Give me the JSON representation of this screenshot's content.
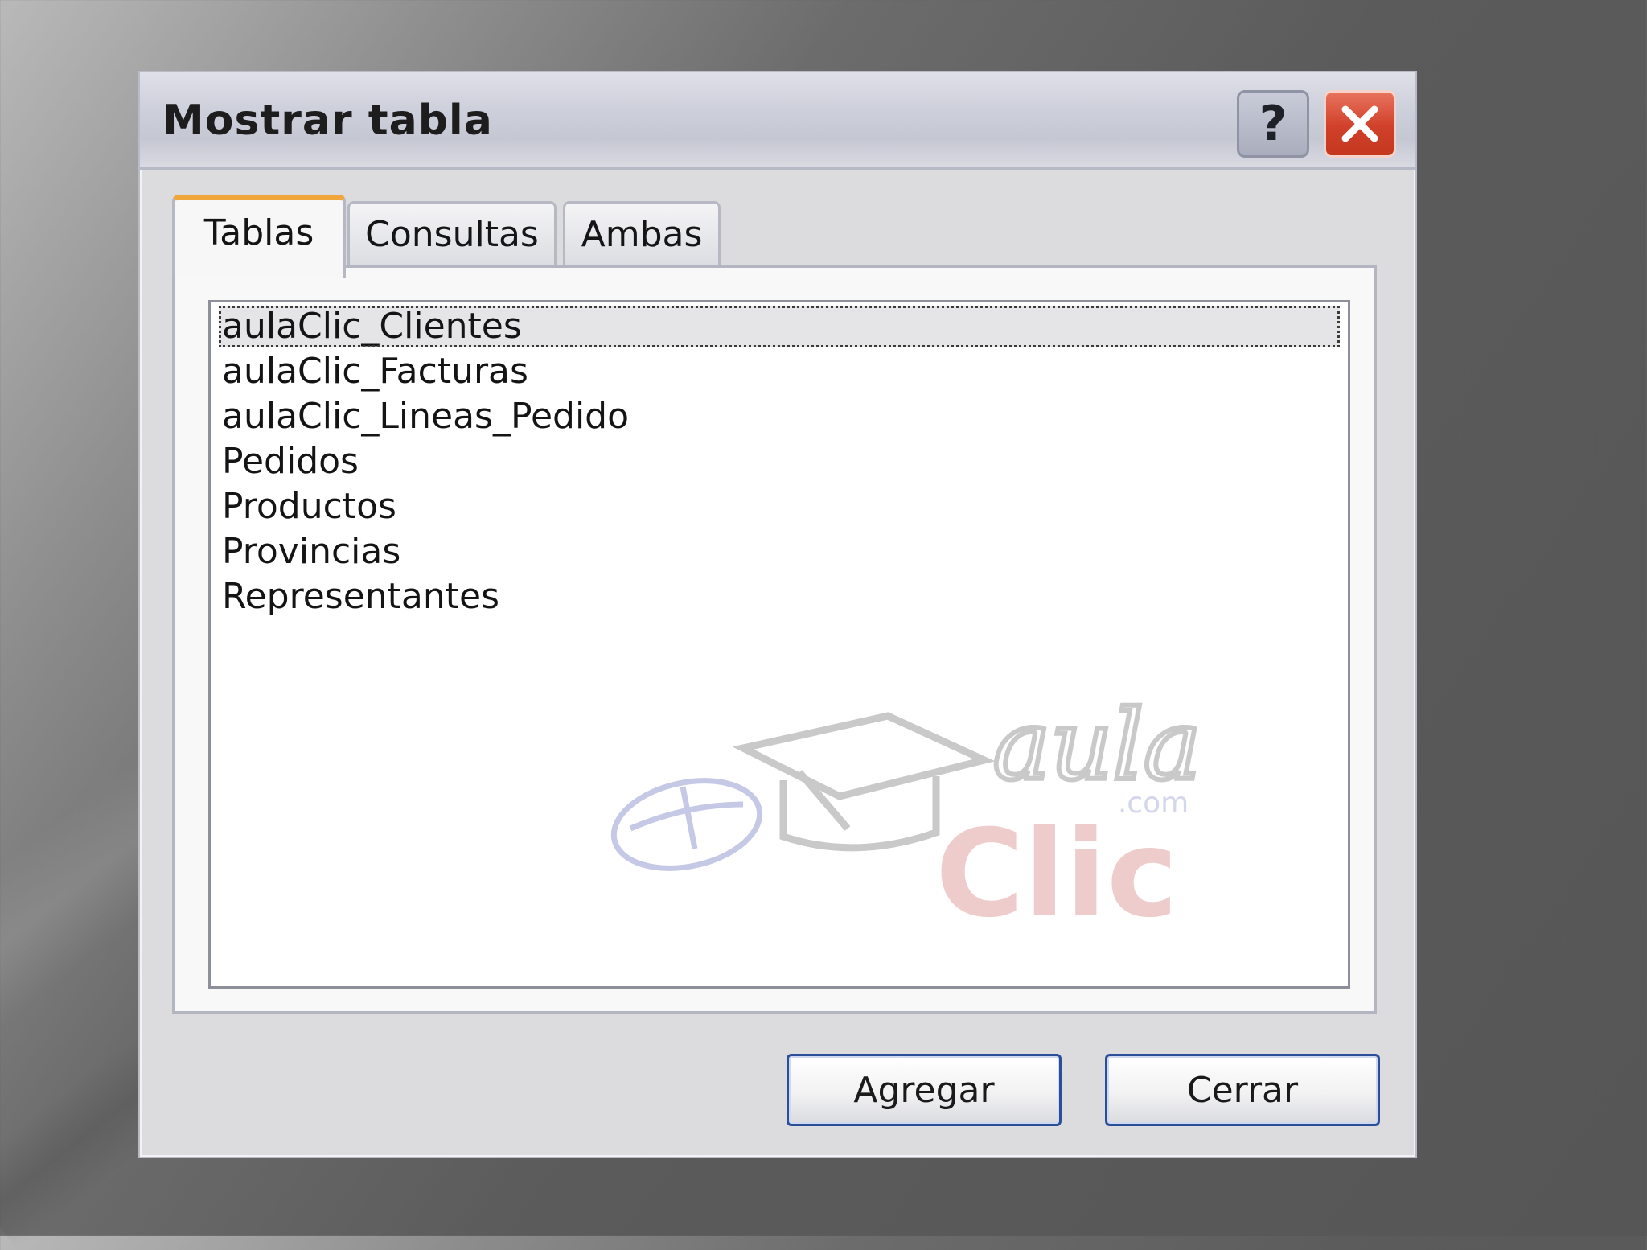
{
  "dialog": {
    "title": "Mostrar tabla",
    "help_label": "?",
    "help_icon": "question-mark-icon",
    "close_icon": "close-x-icon"
  },
  "tabs": [
    {
      "label": "Tablas",
      "active": true
    },
    {
      "label": "Consultas",
      "active": false
    },
    {
      "label": "Ambas",
      "active": false
    }
  ],
  "tables_list": {
    "items": [
      "aulaClic_Clientes",
      "aulaClic_Facturas",
      "aulaClic_Lineas_Pedido",
      "Pedidos",
      "Productos",
      "Provincias",
      "Representantes"
    ],
    "selected_index": 0
  },
  "buttons": {
    "add_label": "Agregar",
    "close_label": "Cerrar"
  },
  "watermark": {
    "line1": "aula",
    "line2": "Clic",
    "suffix": ".com"
  },
  "colors": {
    "active_tab_accent": "#f0a63a",
    "close_button": "#d0402a",
    "button_border": "#2a4f98"
  }
}
